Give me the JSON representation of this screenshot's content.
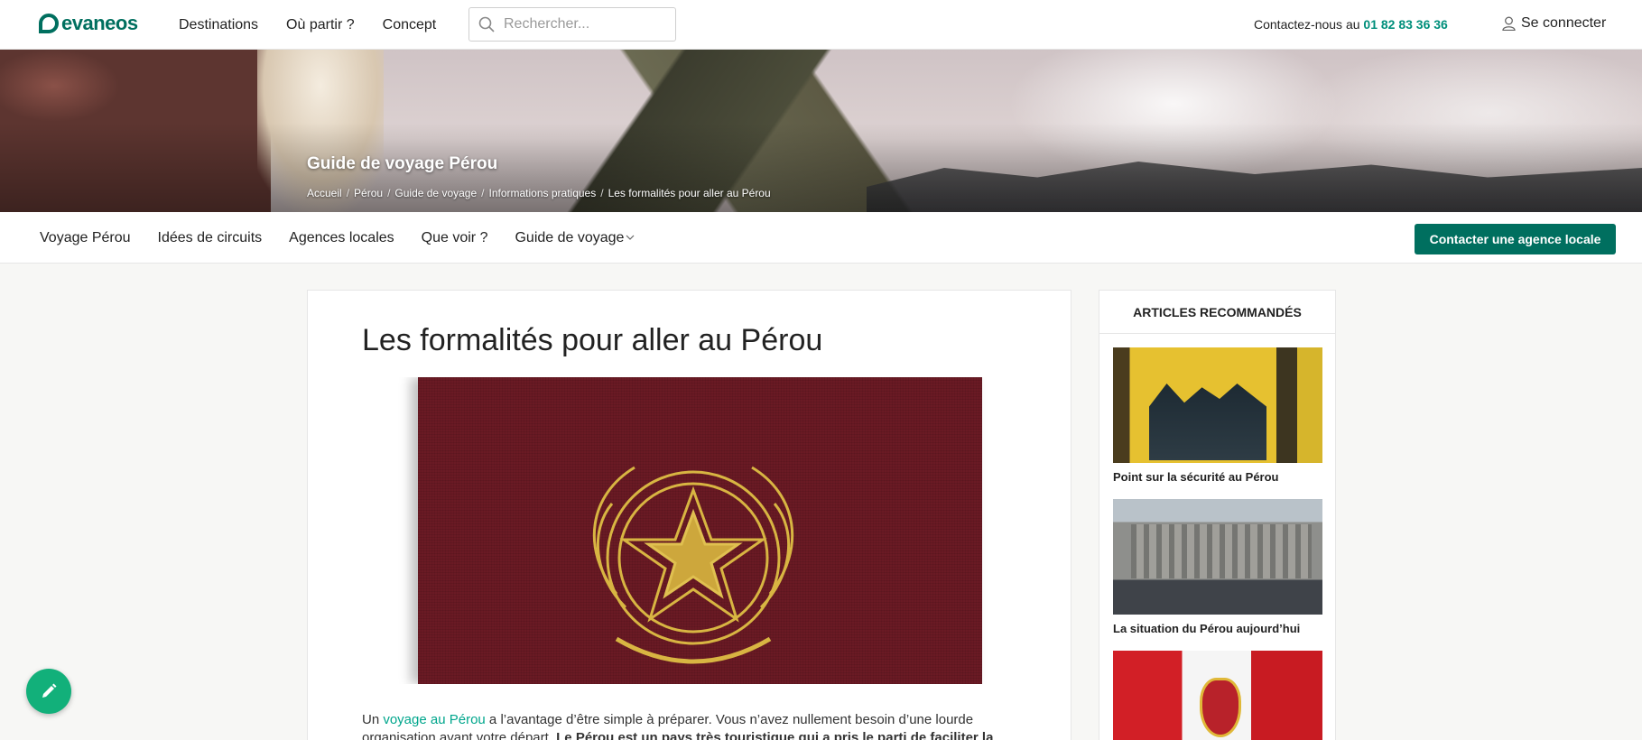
{
  "header": {
    "logo_text": "evaneos",
    "nav": [
      "Destinations",
      "Où partir ?",
      "Concept"
    ],
    "search_placeholder": "Rechercher...",
    "contact_prefix": "Contactez-nous au",
    "phone": "01 82 83 36 36",
    "login_label": "Se connecter"
  },
  "hero": {
    "title": "Guide de voyage Pérou",
    "breadcrumb": [
      "Accueil",
      "Pérou",
      "Guide de voyage",
      "Informations pratiques",
      "Les formalités pour aller au Pérou"
    ]
  },
  "subnav": {
    "items": [
      "Voyage Pérou",
      "Idées de circuits",
      "Agences locales",
      "Que voir ?",
      "Guide de voyage"
    ],
    "cta_label": "Contacter une agence locale"
  },
  "article": {
    "title": "Les formalités pour aller au Pérou",
    "intro_before_link": "Un ",
    "intro_link": "voyage au Pérou",
    "intro_after_link": " a l’avantage d’être simple à préparer. Vous n’avez nullement besoin d’une lourde organisation avant votre départ. ",
    "intro_bold": "Le Pérou est un pays très touristique qui a pris le parti de faciliter la"
  },
  "sidebar": {
    "heading": "ARTICLES RECOMMANDÉS",
    "items": [
      {
        "caption": "Point sur la sécurité au Pérou"
      },
      {
        "caption": "La situation du Pérou aujourd’hui"
      },
      {
        "caption": ""
      }
    ]
  },
  "colors": {
    "brand": "#006f5f",
    "link": "#00a68c",
    "fab": "#12b07a"
  },
  "icons": [
    "search-icon",
    "user-icon",
    "chevron-down-icon",
    "pencil-icon"
  ]
}
